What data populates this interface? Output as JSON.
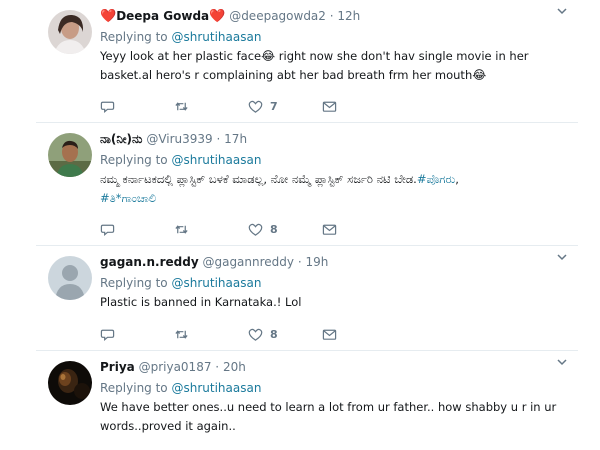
{
  "tweets": [
    {
      "name_prefix": "❤️",
      "name": "Deepa Gowda",
      "name_suffix": "❤️",
      "handle": "@deepagowda2",
      "dot": "·",
      "time": "12h",
      "replying_label": "Replying to",
      "replying_to": "@shrutihaasan",
      "text_parts": [
        "Yeyy look at her plastic face",
        "😂",
        " right now she don't hav single movie in her basket.al hero's r complaining abt her bad breath frm her mouth",
        "😂"
      ],
      "like_count": "7",
      "avatar": "woman-photo"
    },
    {
      "name": "ನಾ(ನೀ)ನು",
      "handle": "@Viru3939",
      "dot": "·",
      "time": "17h",
      "replying_label": "Replying to",
      "replying_to": "@shrutihaasan",
      "text_parts": [
        "ನಮ್ಮ ಕರ್ನಾಟಕದಲ್ಲಿ ಪ್ಲಾಸ್ಟಿಕ್ ಬಳಕೆ ಮಾಡಲ್ಲ, ನೋ ನಮ್ಮೆ ಪ್ಲಾಸ್ಟಿಕ್ ಸರ್ಜರಿ ನಟಿ ಬೇಡ.",
        "#ಪೊಗರು",
        ",",
        "#ತಿ*ಗಾಂಚಾಲಿ"
      ],
      "like_count": "8",
      "avatar": "man-photo"
    },
    {
      "name": "gagan.n.reddy",
      "handle": "@gagannreddy",
      "dot": "·",
      "time": "19h",
      "replying_label": "Replying to",
      "replying_to": "@shrutihaasan",
      "text": "Plastic is banned in Karnataka.! Lol",
      "like_count": "8",
      "avatar": "default-avatar"
    },
    {
      "name": "Priya",
      "handle": "@priya0187",
      "dot": "·",
      "time": "20h",
      "replying_label": "Replying to",
      "replying_to": "@shrutihaasan",
      "text": "We have better ones..u need to learn a lot from ur father.. how shabby u r in ur words..proved it again..",
      "avatar": "dark-photo"
    }
  ],
  "icons": {
    "reply": "reply-icon",
    "retweet": "retweet-icon",
    "like": "heart-outline-icon",
    "dm": "envelope-icon",
    "more": "chevron-down-icon"
  },
  "colors": {
    "link": "#1b7a9c",
    "muted": "#657786",
    "heart": "#e0245e",
    "divider": "#e6ecf0"
  }
}
